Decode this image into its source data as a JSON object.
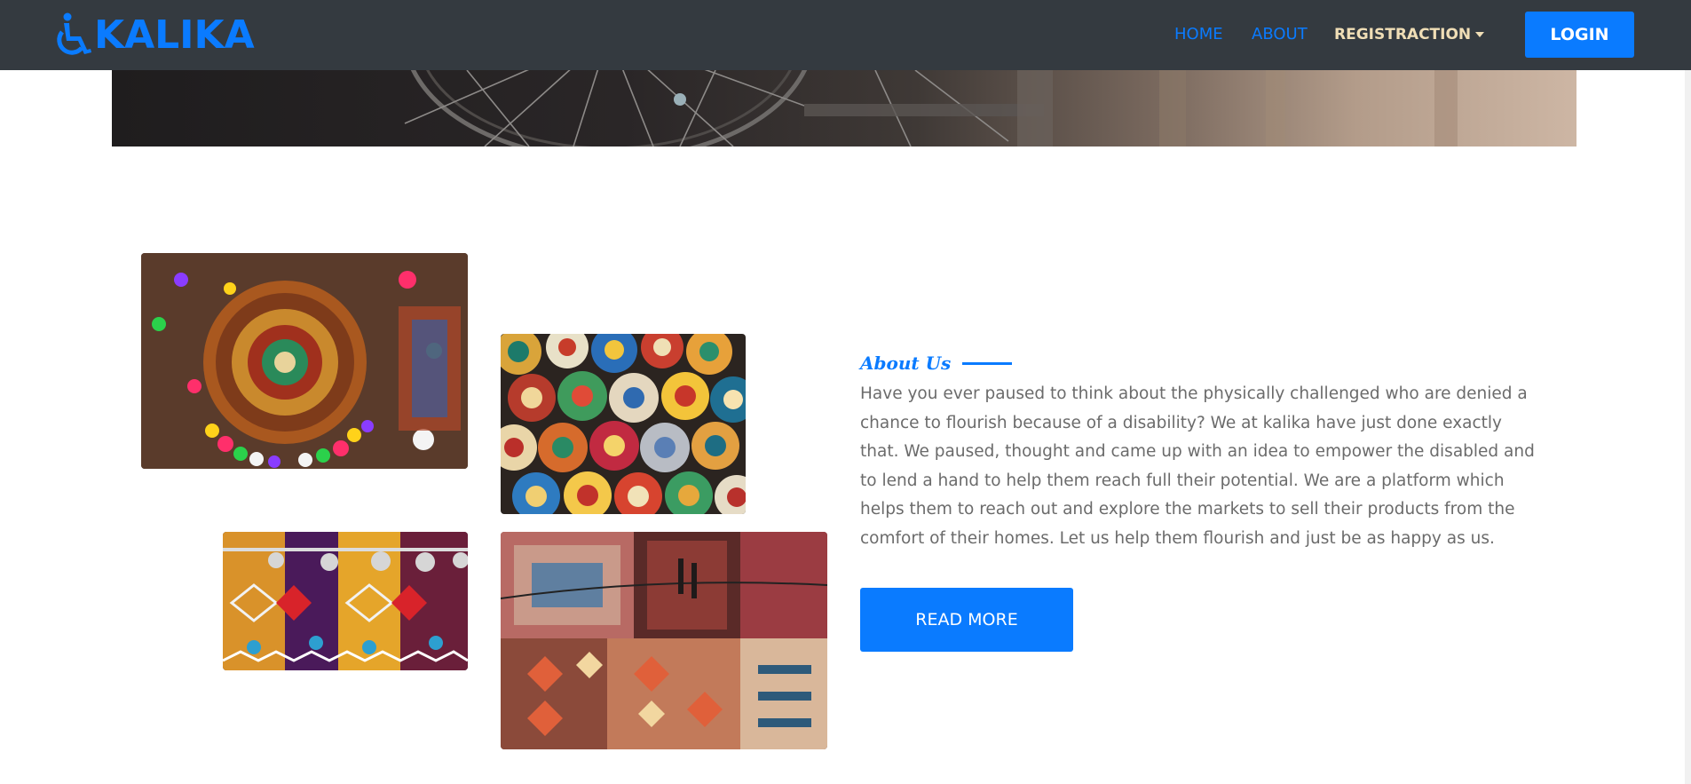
{
  "navbar": {
    "brand": "KALIKA",
    "brand_icon": "wheelchair-icon",
    "links": {
      "home": "HOME",
      "about": "ABOUT",
      "registration": "REGISTRACTION"
    },
    "login_label": "LOGIN"
  },
  "about": {
    "eyebrow": "About Us",
    "paragraph": "Have you ever paused to think about the physically challenged who are denied a chance to flourish because of a disability? We at kalika have just done exactly that. We paused, thought and came up with an idea to empower the disabled and to lend a hand to help them reach full their potential. We are a platform which helps them to reach out and explore the markets to sell their products from the comfort of their homes. Let us help them flourish and just be as happy as us.",
    "read_more_label": "READ MORE"
  },
  "colors": {
    "accent": "#0a7bff",
    "navbar_bg": "#343a40",
    "dropdown_text": "#f0deb6",
    "body_text": "#6b6b6b"
  }
}
